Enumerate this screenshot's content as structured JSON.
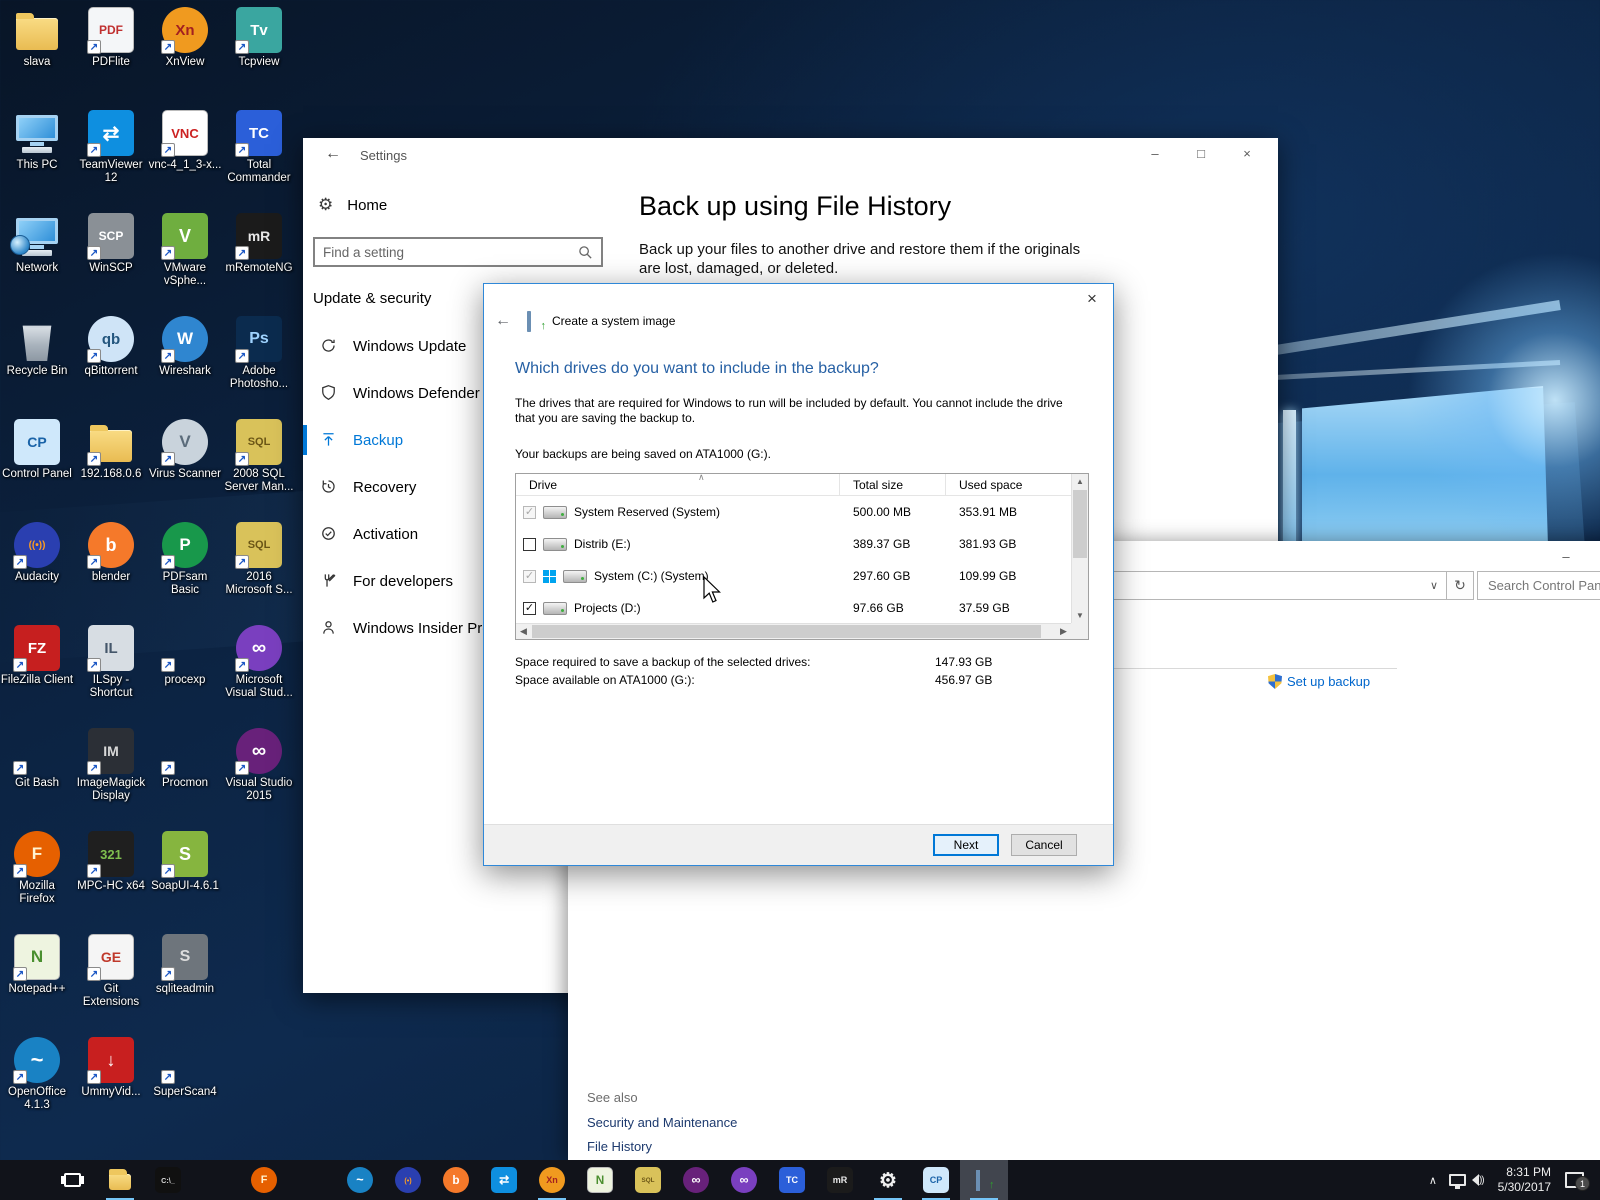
{
  "colors": {
    "accent": "#0078d7",
    "dialog_border": "#2f88d8",
    "link_blue": "#0066cc",
    "wizard_heading_blue": "#2660a4",
    "taskbar_bg": "#11131a",
    "running_underline": "#76c5f7"
  },
  "desktop": {
    "icons": [
      {
        "label": "slava",
        "col": 1,
        "row": 1,
        "kind": "folder",
        "shortcut": false
      },
      {
        "label": "PDFlite",
        "col": 2,
        "row": 1,
        "kind": "tile",
        "bg": "#f4f6f8",
        "fg": "#c03030",
        "text": "PDF",
        "fs": 12,
        "shortcut": true
      },
      {
        "label": "XnView",
        "col": 3,
        "row": 1,
        "kind": "circle",
        "bg": "#f09a1f",
        "fg": "#a32020",
        "text": "Xn",
        "fs": 15,
        "shortcut": true
      },
      {
        "label": "Tcpview",
        "col": 4,
        "row": 1,
        "kind": "tile",
        "bg": "#3aa6a0",
        "fg": "#ffffff",
        "text": "Tv",
        "fs": 15,
        "shortcut": true
      },
      {
        "label": "This PC",
        "col": 1,
        "row": 2,
        "kind": "pc",
        "shortcut": false
      },
      {
        "label": "TeamViewer 12",
        "col": 2,
        "row": 2,
        "kind": "tile",
        "bg": "#0e8fe0",
        "fg": "#ffffff",
        "text": "⇄",
        "fs": 20,
        "shortcut": true
      },
      {
        "label": "vnc-4_1_3-x...",
        "col": 3,
        "row": 2,
        "kind": "tile",
        "bg": "#ffffff",
        "fg": "#cc2222",
        "text": "VNC",
        "fs": 13,
        "shortcut": true
      },
      {
        "label": "Total Commander",
        "col": 4,
        "row": 2,
        "kind": "tile",
        "bg": "#2b5fd9",
        "fg": "#ffffff",
        "text": "TC",
        "fs": 15,
        "shortcut": true
      },
      {
        "label": "Network",
        "col": 1,
        "row": 3,
        "kind": "pc-globe",
        "shortcut": false
      },
      {
        "label": "WinSCP",
        "col": 2,
        "row": 3,
        "kind": "tile",
        "bg": "#8a9096",
        "fg": "#ffffff",
        "text": "SCP",
        "fs": 12,
        "shortcut": true
      },
      {
        "label": "VMware vSphe...",
        "col": 3,
        "row": 3,
        "kind": "tile",
        "bg": "#6fae3f",
        "fg": "#ffffff",
        "text": "V",
        "fs": 18,
        "shortcut": true
      },
      {
        "label": "mRemoteNG",
        "col": 4,
        "row": 3,
        "kind": "tile",
        "bg": "#1b1b1b",
        "fg": "#e8e8e8",
        "text": "mR",
        "fs": 14,
        "shortcut": true
      },
      {
        "label": "Recycle Bin",
        "col": 1,
        "row": 4,
        "kind": "bin",
        "shortcut": false
      },
      {
        "label": "qBittorrent",
        "col": 2,
        "row": 4,
        "kind": "circle",
        "bg": "#cfe4f7",
        "fg": "#24567e",
        "text": "qb",
        "fs": 15,
        "shortcut": true
      },
      {
        "label": "Wireshark",
        "col": 3,
        "row": 4,
        "kind": "circle",
        "bg": "#2f86d0",
        "fg": "#ffffff",
        "text": "W",
        "fs": 17,
        "shortcut": true
      },
      {
        "label": "Adobe Photosho...",
        "col": 4,
        "row": 4,
        "kind": "tile",
        "bg": "#0b2b4e",
        "fg": "#9fd3ff",
        "text": "Ps",
        "fs": 16,
        "shortcut": true
      },
      {
        "label": "Control Panel",
        "col": 1,
        "row": 5,
        "kind": "tile",
        "bg": "#cfe8fb",
        "fg": "#1a63a8",
        "text": "CP",
        "fs": 14,
        "shortcut": false
      },
      {
        "label": "192.168.0.6",
        "col": 2,
        "row": 5,
        "kind": "folder",
        "shortcut": true
      },
      {
        "label": "Virus Scanner",
        "col": 3,
        "row": 5,
        "kind": "circle",
        "bg": "#c9d3dc",
        "fg": "#5a6b7a",
        "text": "V",
        "fs": 17,
        "shortcut": true
      },
      {
        "label": "2008 SQL Server Man...",
        "col": 4,
        "row": 5,
        "kind": "tile",
        "bg": "#d9c25a",
        "fg": "#6b5616",
        "text": "SQL",
        "fs": 11,
        "shortcut": true
      },
      {
        "label": "Audacity",
        "col": 1,
        "row": 6,
        "kind": "circle",
        "bg": "#2a3fb0",
        "fg": "#ff9d1f",
        "text": "((•))",
        "fs": 10,
        "shortcut": true
      },
      {
        "label": "blender",
        "col": 2,
        "row": 6,
        "kind": "circle",
        "bg": "#f5792a",
        "fg": "#ffffff",
        "text": "b",
        "fs": 18,
        "shortcut": true
      },
      {
        "label": "PDFsam Basic",
        "col": 3,
        "row": 6,
        "kind": "circle",
        "bg": "#18984b",
        "fg": "#ffffff",
        "text": "P",
        "fs": 17,
        "shortcut": true
      },
      {
        "label": "2016 Microsoft S...",
        "col": 4,
        "row": 6,
        "kind": "tile",
        "bg": "#d9c25a",
        "fg": "#6b5616",
        "text": "SQL",
        "fs": 11,
        "shortcut": true
      },
      {
        "label": "FileZilla Client",
        "col": 1,
        "row": 7,
        "kind": "tile",
        "bg": "#c61f1f",
        "fg": "#ffffff",
        "text": "FZ",
        "fs": 15,
        "shortcut": true
      },
      {
        "label": "ILSpy - Shortcut",
        "col": 2,
        "row": 7,
        "kind": "tile",
        "bg": "#d7dde3",
        "fg": "#44566a",
        "text": "IL",
        "fs": 15,
        "shortcut": true
      },
      {
        "label": "procexp",
        "col": 3,
        "row": 7,
        "kind": "winflag",
        "shortcut": true
      },
      {
        "label": "Microsoft Visual Stud...",
        "col": 4,
        "row": 7,
        "kind": "circle",
        "bg": "#7a3fbf",
        "fg": "#ffffff",
        "text": "∞",
        "fs": 20,
        "shortcut": true
      },
      {
        "label": "Git Bash",
        "col": 1,
        "row": 8,
        "kind": "quad",
        "colors": [
          "#e05252",
          "#7fbf4f",
          "#4f9fd9",
          "#f0c24f"
        ],
        "shortcut": true
      },
      {
        "label": "ImageMagick Display",
        "col": 2,
        "row": 8,
        "kind": "tile",
        "bg": "#2b2f36",
        "fg": "#d8d8d8",
        "text": "IM",
        "fs": 14,
        "shortcut": true
      },
      {
        "label": "Procmon",
        "col": 3,
        "row": 8,
        "kind": "winflag",
        "shortcut": true
      },
      {
        "label": "Visual Studio 2015",
        "col": 4,
        "row": 8,
        "kind": "circle",
        "bg": "#68217a",
        "fg": "#ffffff",
        "text": "∞",
        "fs": 20,
        "shortcut": true
      },
      {
        "label": "Mozilla Firefox",
        "col": 1,
        "row": 9,
        "kind": "circle",
        "bg": "#e66000",
        "fg": "#fff3d0",
        "text": "F",
        "fs": 17,
        "shortcut": true
      },
      {
        "label": "MPC-HC x64",
        "col": 2,
        "row": 9,
        "kind": "tile",
        "bg": "#1f1f1f",
        "fg": "#7fbf4f",
        "text": "321",
        "fs": 13,
        "shortcut": true
      },
      {
        "label": "SoapUI-4.6.1",
        "col": 3,
        "row": 9,
        "kind": "tile",
        "bg": "#86b53f",
        "fg": "#ffffff",
        "text": "S",
        "fs": 18,
        "shortcut": true
      },
      {
        "label": "Notepad++",
        "col": 1,
        "row": 10,
        "kind": "tile",
        "bg": "#eef4e0",
        "fg": "#4a8f2f",
        "text": "N",
        "fs": 17,
        "shortcut": true
      },
      {
        "label": "Git Extensions",
        "col": 2,
        "row": 10,
        "kind": "tile",
        "bg": "#f5f5f5",
        "fg": "#c0392b",
        "text": "GE",
        "fs": 14,
        "shortcut": true
      },
      {
        "label": "sqliteadmin",
        "col": 3,
        "row": 10,
        "kind": "tile",
        "bg": "#6e757c",
        "fg": "#dddddd",
        "text": "S",
        "fs": 16,
        "shortcut": true
      },
      {
        "label": "OpenOffice 4.1.3",
        "col": 1,
        "row": 11,
        "kind": "circle",
        "bg": "#1982c4",
        "fg": "#ffffff",
        "text": "~",
        "fs": 22,
        "shortcut": true
      },
      {
        "label": "UmmyVid...",
        "col": 2,
        "row": 11,
        "kind": "tile",
        "bg": "#c81f1f",
        "fg": "#ffffff",
        "text": "↓",
        "fs": 18,
        "shortcut": true
      },
      {
        "label": "SuperScan4",
        "col": 3,
        "row": 11,
        "kind": "quad",
        "colors": [
          "#3fd93f",
          "#f0e63f",
          "#3fd9d9",
          "#d93f3f"
        ],
        "shortcut": true
      }
    ]
  },
  "settings": {
    "title": "Settings",
    "back_glyph": "←",
    "chrome": {
      "minimize": "–",
      "maximize": "□",
      "close": "×"
    },
    "home_label": "Home",
    "search_placeholder": "Find a setting",
    "section": "Update & security",
    "nav_items": [
      {
        "label": "Windows Update",
        "icon": "update",
        "selected": false
      },
      {
        "label": "Windows Defender",
        "icon": "defender",
        "selected": false
      },
      {
        "label": "Backup",
        "icon": "backup",
        "selected": true
      },
      {
        "label": "Recovery",
        "icon": "recovery",
        "selected": false
      },
      {
        "label": "Activation",
        "icon": "activation",
        "selected": false
      },
      {
        "label": "For developers",
        "icon": "developers",
        "selected": false
      },
      {
        "label": "Windows Insider Program",
        "icon": "insider",
        "selected": false
      }
    ],
    "main_heading": "Back up using File History",
    "main_description": "Back up your files to another drive and restore them if the originals are lost, damaged, or deleted."
  },
  "control_panel": {
    "chrome_minimize": "–",
    "combo_chevron": "∨",
    "refresh_glyph": "↻",
    "search_placeholder": "Search Control Panel",
    "setup_backup_link": "Set up backup",
    "see_also_heading": "See also",
    "see_also_links": [
      "Security and Maintenance",
      "File History"
    ]
  },
  "dialog": {
    "close_glyph": "×",
    "back_glyph": "←",
    "title": "Create a system image",
    "heading": "Which drives do you want to include in the backup?",
    "description": "The drives that are required for Windows to run will be included by default. You cannot include the drive that you are saving the backup to.",
    "backup_location_note": "Your backups are being saved on ATA1000 (G:).",
    "table": {
      "columns": [
        "Drive",
        "Total size",
        "Used space"
      ],
      "rows": [
        {
          "name": "System Reserved (System)",
          "total": "500.00 MB",
          "used": "353.91 MB",
          "checked": true,
          "disabled": true,
          "windows_logo": false
        },
        {
          "name": "Distrib (E:)",
          "total": "389.37 GB",
          "used": "381.93 GB",
          "checked": false,
          "disabled": false,
          "windows_logo": false
        },
        {
          "name": "System (C:) (System)",
          "total": "297.60 GB",
          "used": "109.99 GB",
          "checked": true,
          "disabled": true,
          "windows_logo": true
        },
        {
          "name": "Projects (D:)",
          "total": "97.66 GB",
          "used": "37.59 GB",
          "checked": true,
          "disabled": false,
          "windows_logo": false
        }
      ]
    },
    "space_required_label": "Space required to save a backup of the selected drives:",
    "space_required_value": "147.93 GB",
    "space_available_label": "Space available on ATA1000 (G:):",
    "space_available_value": "456.97 GB",
    "next_button": "Next",
    "cancel_button": "Cancel"
  },
  "taskbar": {
    "icons": [
      {
        "name": "start-button",
        "kind": "start"
      },
      {
        "name": "task-view-button",
        "kind": "taskview"
      },
      {
        "name": "file-explorer",
        "kind": "folder",
        "running": true
      },
      {
        "name": "command-prompt",
        "kind": "tile",
        "bg": "#101010",
        "fg": "#d8d8d8",
        "text": "C:\\_",
        "fs": 8
      },
      {
        "name": "process-explorer",
        "kind": "winflag"
      },
      {
        "name": "firefox",
        "kind": "circle",
        "bg": "#e66000",
        "fg": "#fff3d0",
        "text": "F",
        "fs": 12
      },
      {
        "name": "colorful-app",
        "kind": "quad",
        "colors": [
          "#d96fd9",
          "#7fbf4f",
          "#8f5fd9",
          "#f0a24f"
        ]
      },
      {
        "name": "openoffice",
        "kind": "circle",
        "bg": "#1982c4",
        "fg": "#ffffff",
        "text": "~",
        "fs": 14
      },
      {
        "name": "audacity",
        "kind": "circle",
        "bg": "#2a3fb0",
        "fg": "#ff9d1f",
        "text": "(•)",
        "fs": 8
      },
      {
        "name": "blender",
        "kind": "circle",
        "bg": "#f5792a",
        "fg": "#ffffff",
        "text": "b",
        "fs": 13
      },
      {
        "name": "teamviewer",
        "kind": "tile",
        "bg": "#0e8fe0",
        "fg": "#ffffff",
        "text": "⇄",
        "fs": 13
      },
      {
        "name": "xnview",
        "kind": "circle",
        "bg": "#f09a1f",
        "fg": "#a32020",
        "text": "Xn",
        "fs": 10,
        "running": true
      },
      {
        "name": "notepad-plus-plus",
        "kind": "tile",
        "bg": "#eef4e0",
        "fg": "#4a8f2f",
        "text": "N",
        "fs": 13
      },
      {
        "name": "sql-tools",
        "kind": "tile",
        "bg": "#d9c25a",
        "fg": "#6b5616",
        "text": "SQL",
        "fs": 7
      },
      {
        "name": "visual-studio",
        "kind": "circle",
        "bg": "#68217a",
        "fg": "#ffffff",
        "text": "∞",
        "fs": 14
      },
      {
        "name": "vs-community",
        "kind": "circle",
        "bg": "#7a3fbf",
        "fg": "#ffffff",
        "text": "∞",
        "fs": 14
      },
      {
        "name": "total-commander",
        "kind": "tile",
        "bg": "#2b5fd9",
        "fg": "#ffffff",
        "text": "TC",
        "fs": 10
      },
      {
        "name": "mremoteng",
        "kind": "tile",
        "bg": "#1b1b1b",
        "fg": "#e8e8e8",
        "text": "mR",
        "fs": 10
      },
      {
        "name": "settings-gear",
        "kind": "gear",
        "running": true
      },
      {
        "name": "control-panel",
        "kind": "tile",
        "bg": "#cfe8fb",
        "fg": "#1a63a8",
        "text": "CP",
        "fs": 10,
        "running": true
      },
      {
        "name": "system-image-wizard",
        "kind": "wiz",
        "running": true,
        "active": true
      }
    ],
    "tray": {
      "chevron": "∧",
      "time": "8:31 PM",
      "date": "5/30/2017",
      "badge": "1"
    }
  }
}
